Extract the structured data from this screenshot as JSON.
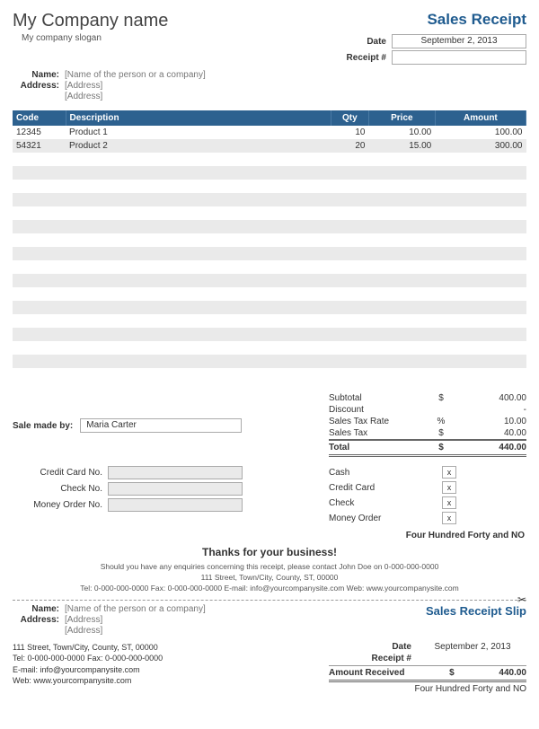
{
  "company": {
    "name": "My Company name",
    "slogan": "My company slogan"
  },
  "title": "Sales Receipt",
  "meta": {
    "date_label": "Date",
    "date": "September 2, 2013",
    "receipt_label": "Receipt #",
    "receipt": ""
  },
  "customer": {
    "name_label": "Name:",
    "name": "[Name of the person or a company]",
    "addr_label": "Address:",
    "addr1": "[Address]",
    "addr2": "[Address]"
  },
  "cols": {
    "code": "Code",
    "desc": "Description",
    "qty": "Qty",
    "price": "Price",
    "amount": "Amount"
  },
  "items": [
    {
      "code": "12345",
      "desc": "Product 1",
      "qty": "10",
      "price": "10.00",
      "amount": "100.00"
    },
    {
      "code": "54321",
      "desc": "Product 2",
      "qty": "20",
      "price": "15.00",
      "amount": "300.00"
    }
  ],
  "blank_rows": 17,
  "sale_made": {
    "label": "Sale made by:",
    "value": "Maria Carter"
  },
  "totals": {
    "subtotal_label": "Subtotal",
    "subtotal": "400.00",
    "discount_label": "Discount",
    "discount": "-",
    "taxrate_label": "Sales Tax Rate",
    "taxrate": "10.00",
    "tax_label": "Sales Tax",
    "tax": "40.00",
    "total_label": "Total",
    "total": "440.00",
    "dollar": "$",
    "percent": "%"
  },
  "payment_ref": {
    "cc": "Credit Card No.",
    "check": "Check No.",
    "mo": "Money Order No."
  },
  "payment_type": {
    "cash": "Cash",
    "cc": "Credit Card",
    "check": "Check",
    "mo": "Money Order",
    "x": "x"
  },
  "amount_words": "Four Hundred Forty and NO",
  "thanks": "Thanks for your business!",
  "footer": {
    "line1": "Should you have any enquiries concerning this receipt, please contact John Doe on 0-000-000-0000",
    "line2": "111 Street, Town/City, County, ST, 00000",
    "line3": "Tel: 0-000-000-0000 Fax: 0-000-000-0000 E-mail: info@yourcompanysite.com Web: www.yourcompanysite.com"
  },
  "slip": {
    "title": "Sales Receipt Slip",
    "addr": "111 Street, Town/City, County, ST, 00000",
    "tel": "Tel: 0-000-000-0000 Fax: 0-000-000-0000",
    "email": "E-mail: info@yourcompanysite.com",
    "web": "Web: www.yourcompanysite.com",
    "amt_label": "Amount Received",
    "amt": "440.00"
  }
}
